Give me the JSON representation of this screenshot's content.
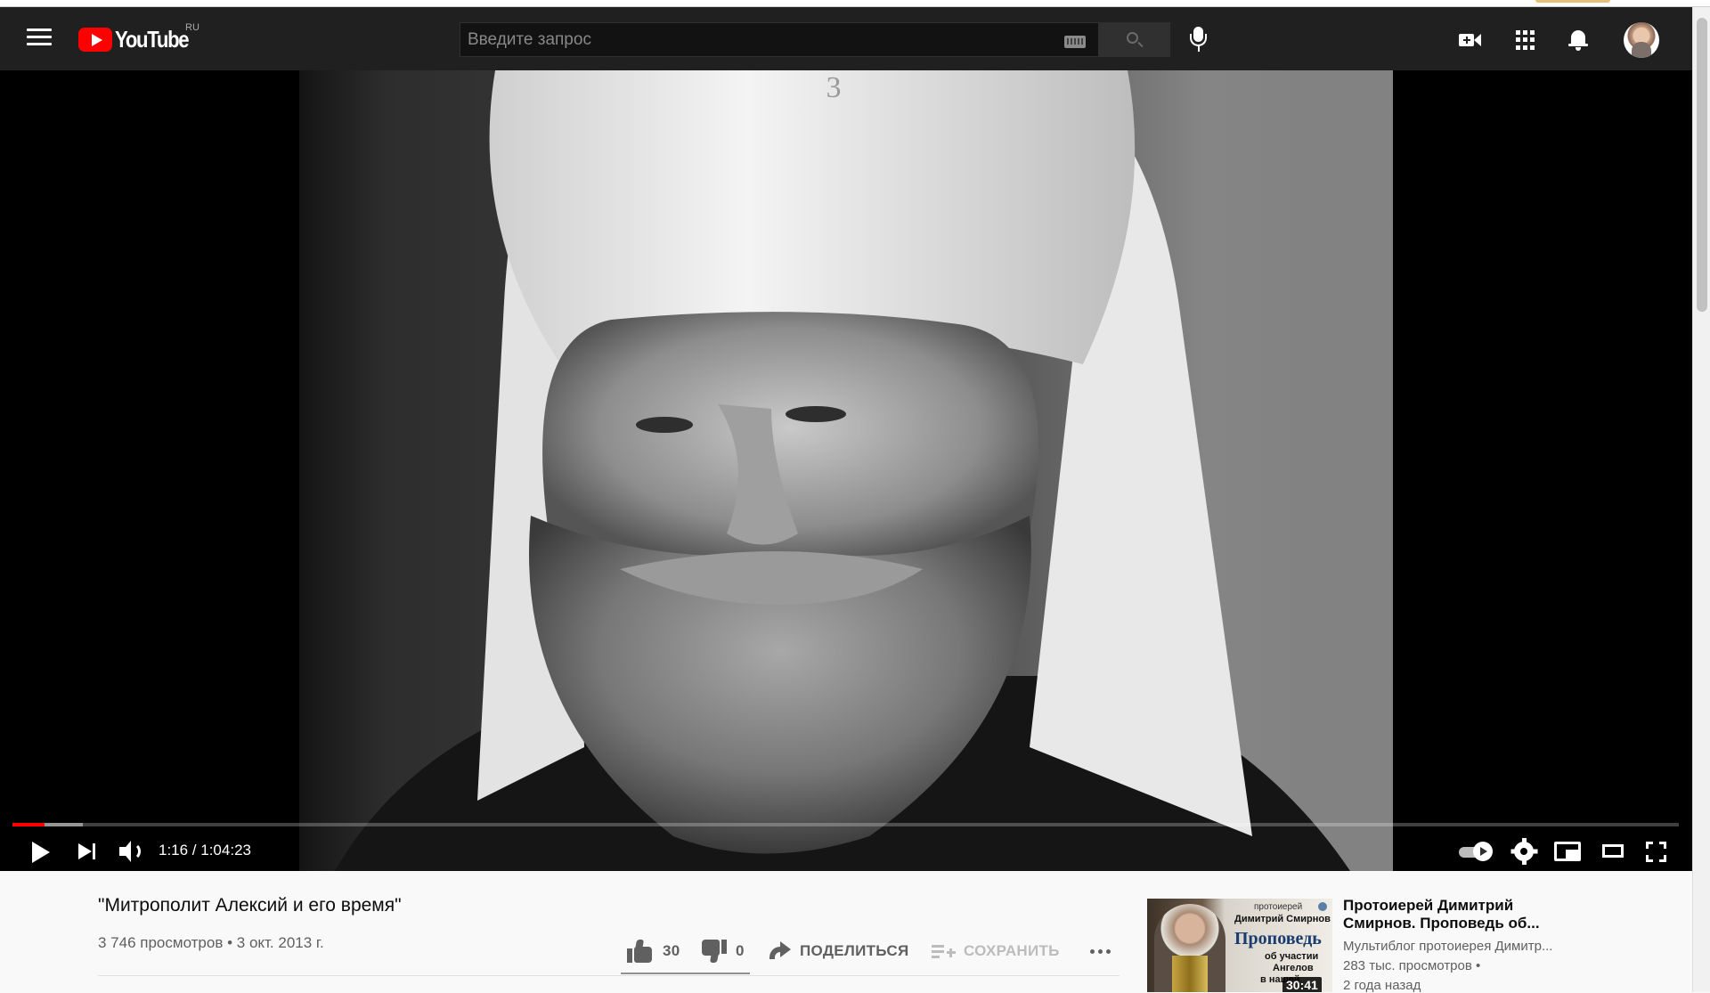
{
  "masthead": {
    "logo_text": "YouTube",
    "region": "RU",
    "search_placeholder": "Введите запрос"
  },
  "player": {
    "time_display": "1:16 / 1:04:23",
    "progress_played_fraction": 0.019,
    "progress_loaded_fraction": 0.042,
    "accent_color": "#ff0000"
  },
  "video": {
    "title": "\"Митрополит Алексий и его время\"",
    "meta": "3 746 просмотров • 3 окт. 2013 г.",
    "likes": "30",
    "dislikes": "0",
    "share_label": "ПОДЕЛИТЬСЯ",
    "save_label": "СОХРАНИТЬ"
  },
  "recommendation": {
    "thumb_line1": "протоиерей",
    "thumb_line2": "Димитрий Смирнов",
    "thumb_line3": "Проповедь",
    "thumb_line4": "об участии",
    "thumb_line5": "Ангелов",
    "thumb_line6": "в нашей",
    "duration": "30:41",
    "title_line1": "Протоиерей Димитрий",
    "title_line2": "Смирнов. Проповедь об...",
    "channel": "Мультиблог протоиерея Димитр...",
    "views": "283 тыс. просмотров •",
    "date": "2 года назад"
  }
}
